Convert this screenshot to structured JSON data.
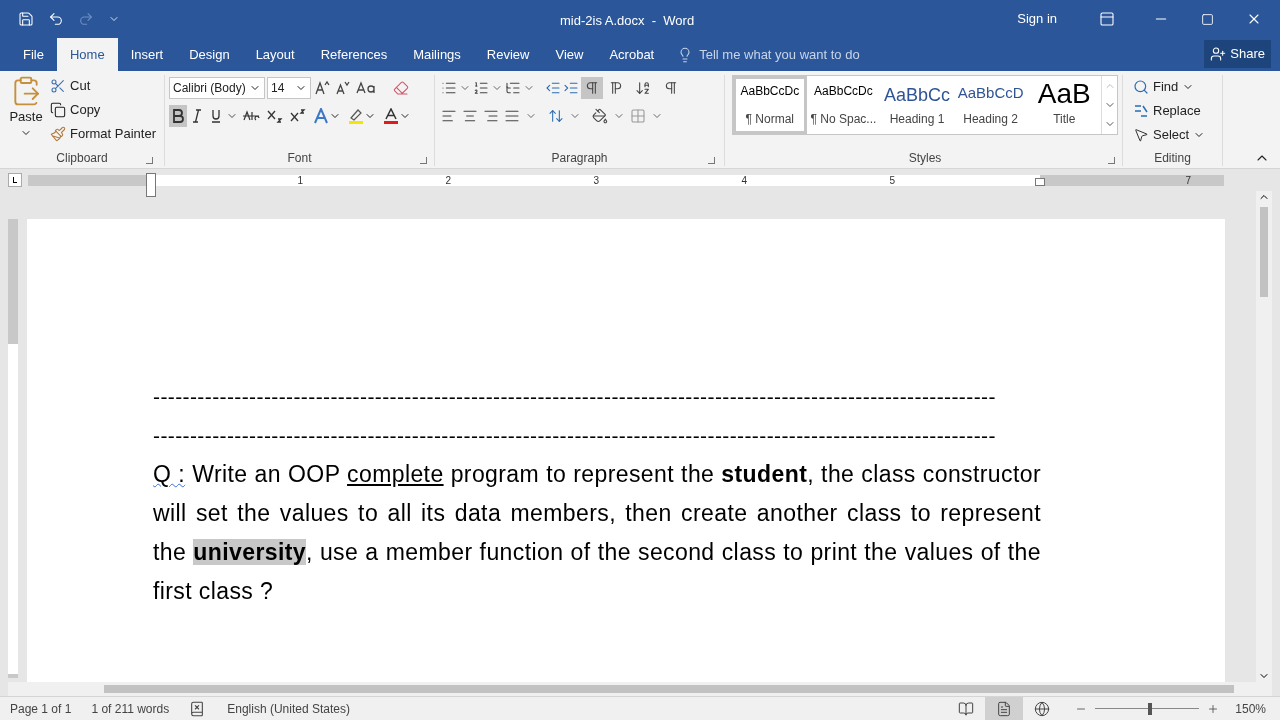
{
  "window": {
    "title": "mid-2is A.docx  -  Word",
    "sign_in": "Sign in"
  },
  "tabs": [
    {
      "label": "File",
      "selected": false
    },
    {
      "label": "Home",
      "selected": true
    },
    {
      "label": "Insert",
      "selected": false
    },
    {
      "label": "Design",
      "selected": false
    },
    {
      "label": "Layout",
      "selected": false
    },
    {
      "label": "References",
      "selected": false
    },
    {
      "label": "Mailings",
      "selected": false
    },
    {
      "label": "Review",
      "selected": false
    },
    {
      "label": "View",
      "selected": false
    },
    {
      "label": "Acrobat",
      "selected": false
    }
  ],
  "tell_me": {
    "placeholder": "Tell me what you want to do"
  },
  "share": "Share",
  "clipboard": {
    "paste": "Paste",
    "cut": "Cut",
    "copy": "Copy",
    "format_painter": "Format Painter",
    "label": "Clipboard"
  },
  "font": {
    "name": "Calibri (Body)",
    "size": "14",
    "bold": true,
    "label": "Font"
  },
  "paragraph": {
    "left_to_right": true,
    "label": "Paragraph"
  },
  "styles": {
    "label": "Styles",
    "items": [
      {
        "preview": "AaBbCcDc",
        "name": "¶ Normal",
        "kind": "body",
        "selected": true
      },
      {
        "preview": "AaBbCcDc",
        "name": "¶ No Spac...",
        "kind": "body",
        "selected": false
      },
      {
        "preview": "AaBbCc",
        "name": "Heading 1",
        "kind": "heading1",
        "selected": false
      },
      {
        "preview": "AaBbCcD",
        "name": "Heading 2",
        "kind": "heading2",
        "selected": false
      },
      {
        "preview": "AaB",
        "name": "Title",
        "kind": "title",
        "selected": false
      }
    ]
  },
  "editing": {
    "find": "Find",
    "replace": "Replace",
    "select": "Select",
    "label": "Editing"
  },
  "ruler": {
    "labels": [
      "1",
      "2",
      "3",
      "4",
      "5",
      "7"
    ]
  },
  "document": {
    "rules": [
      "------------------------------------------------------------------------------------------------------------------",
      "------------------------------------------------------------------------------------------------------------------"
    ],
    "runs": [
      {
        "kind": "misspelled",
        "text": "Q :"
      },
      {
        "kind": "plain",
        "text": " Write an OOP "
      },
      {
        "kind": "underline",
        "text": "complete"
      },
      {
        "kind": "plain",
        "text": " program to represent the "
      },
      {
        "kind": "bold",
        "text": "student"
      },
      {
        "kind": "plain",
        "text": ", the class constructor will set the values to all its data members, then create another class to represent the "
      },
      {
        "kind": "selected_bold",
        "text": "university"
      },
      {
        "kind": "plain",
        "text": ", use a member function of the second class to print the values of the first class ?"
      }
    ]
  },
  "status_bar": {
    "page": "Page 1 of 1",
    "words": "1 of 211 words",
    "language": "English (United States)",
    "views": [
      {
        "kind": "read",
        "selected": false
      },
      {
        "kind": "print",
        "selected": true
      },
      {
        "kind": "web",
        "selected": false
      }
    ],
    "zoom": "150%",
    "level": 0.53
  }
}
